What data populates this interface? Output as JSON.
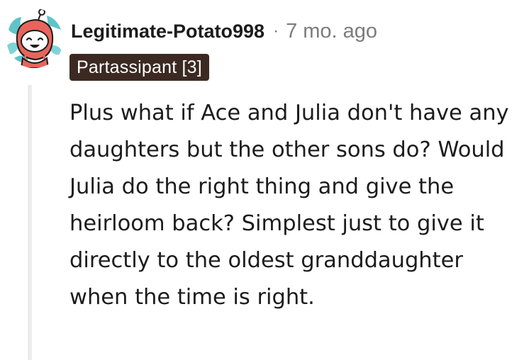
{
  "comment": {
    "author": "Legitimate-Potato998",
    "separator": "·",
    "timestamp": "7 mo. ago",
    "flair": "Partassipant [3]",
    "body": "Plus what if Ace and Julia don't have any daughters but the other sons do? Would Julia do the right thing and give the heirloom back? Simplest just to give it directly to the oldest granddaughter when the time is right."
  },
  "colors": {
    "flair_background": "#3c2a22",
    "flair_text": "#ffffff",
    "author_text": "#1c1c1c",
    "meta_text": "#7c7c7c",
    "body_text": "#1c1c1c",
    "thread_line": "#ececec",
    "avatar_bg": "#5fc4c8",
    "avatar_hood": "#e8655c"
  },
  "icons": {
    "avatar": "snoo-avatar-icon"
  }
}
